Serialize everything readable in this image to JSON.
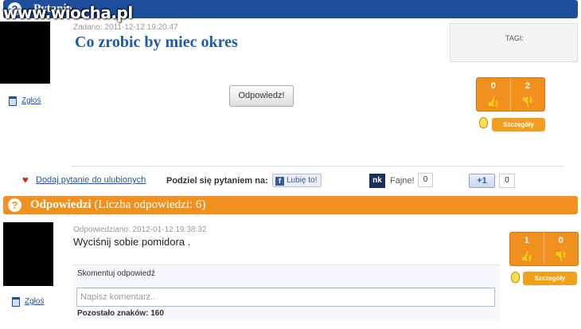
{
  "watermark": "www.wiocha.pl",
  "question_section": {
    "header_icon": "?",
    "header_title": "Pytanie",
    "meta": "Zadano: 2011-12-12 19:20:47",
    "title": "Co zrobic by miec okres",
    "tags_label": "TAGI:",
    "report_label": "Zgłoś",
    "answer_button_label": "Odpowiedz!",
    "votes": {
      "up": "0",
      "down": "2",
      "up_icon": "thumbs-up-icon",
      "down_icon": "thumbs-down-icon"
    },
    "details_label": "Szczegóły"
  },
  "share": {
    "favorite_label": "Dodaj pytanie do ulubionych",
    "share_label": "Podziel się pytaniem na:",
    "facebook_label": "Lubię to!",
    "nk_logo": "nk",
    "nk_label": "Fajne!",
    "nk_count": "0",
    "gplus_label": "+1",
    "gplus_count": "0"
  },
  "answers_section": {
    "header_icon": "?",
    "header_title": "Odpowiedzi",
    "header_count_text": "(Liczba odpowiedzi: 6)",
    "answer": {
      "meta": "Odpowiedziano: 2012-01-12 19:38:32",
      "text": "Wyciśnij sobie pomidora .",
      "report_label": "Zgłoś",
      "votes": {
        "up": "1",
        "down": "0"
      },
      "details_label": "Szczegóły",
      "comment": {
        "label": "Skomentuj odpowiedź",
        "placeholder": "Napisz komentarz..",
        "remaining": "Pozostało znaków: 160"
      }
    }
  },
  "colors": {
    "blue_bar": "#1f4f9c",
    "orange_bar": "#f0901e",
    "link": "#1f5aa8"
  }
}
